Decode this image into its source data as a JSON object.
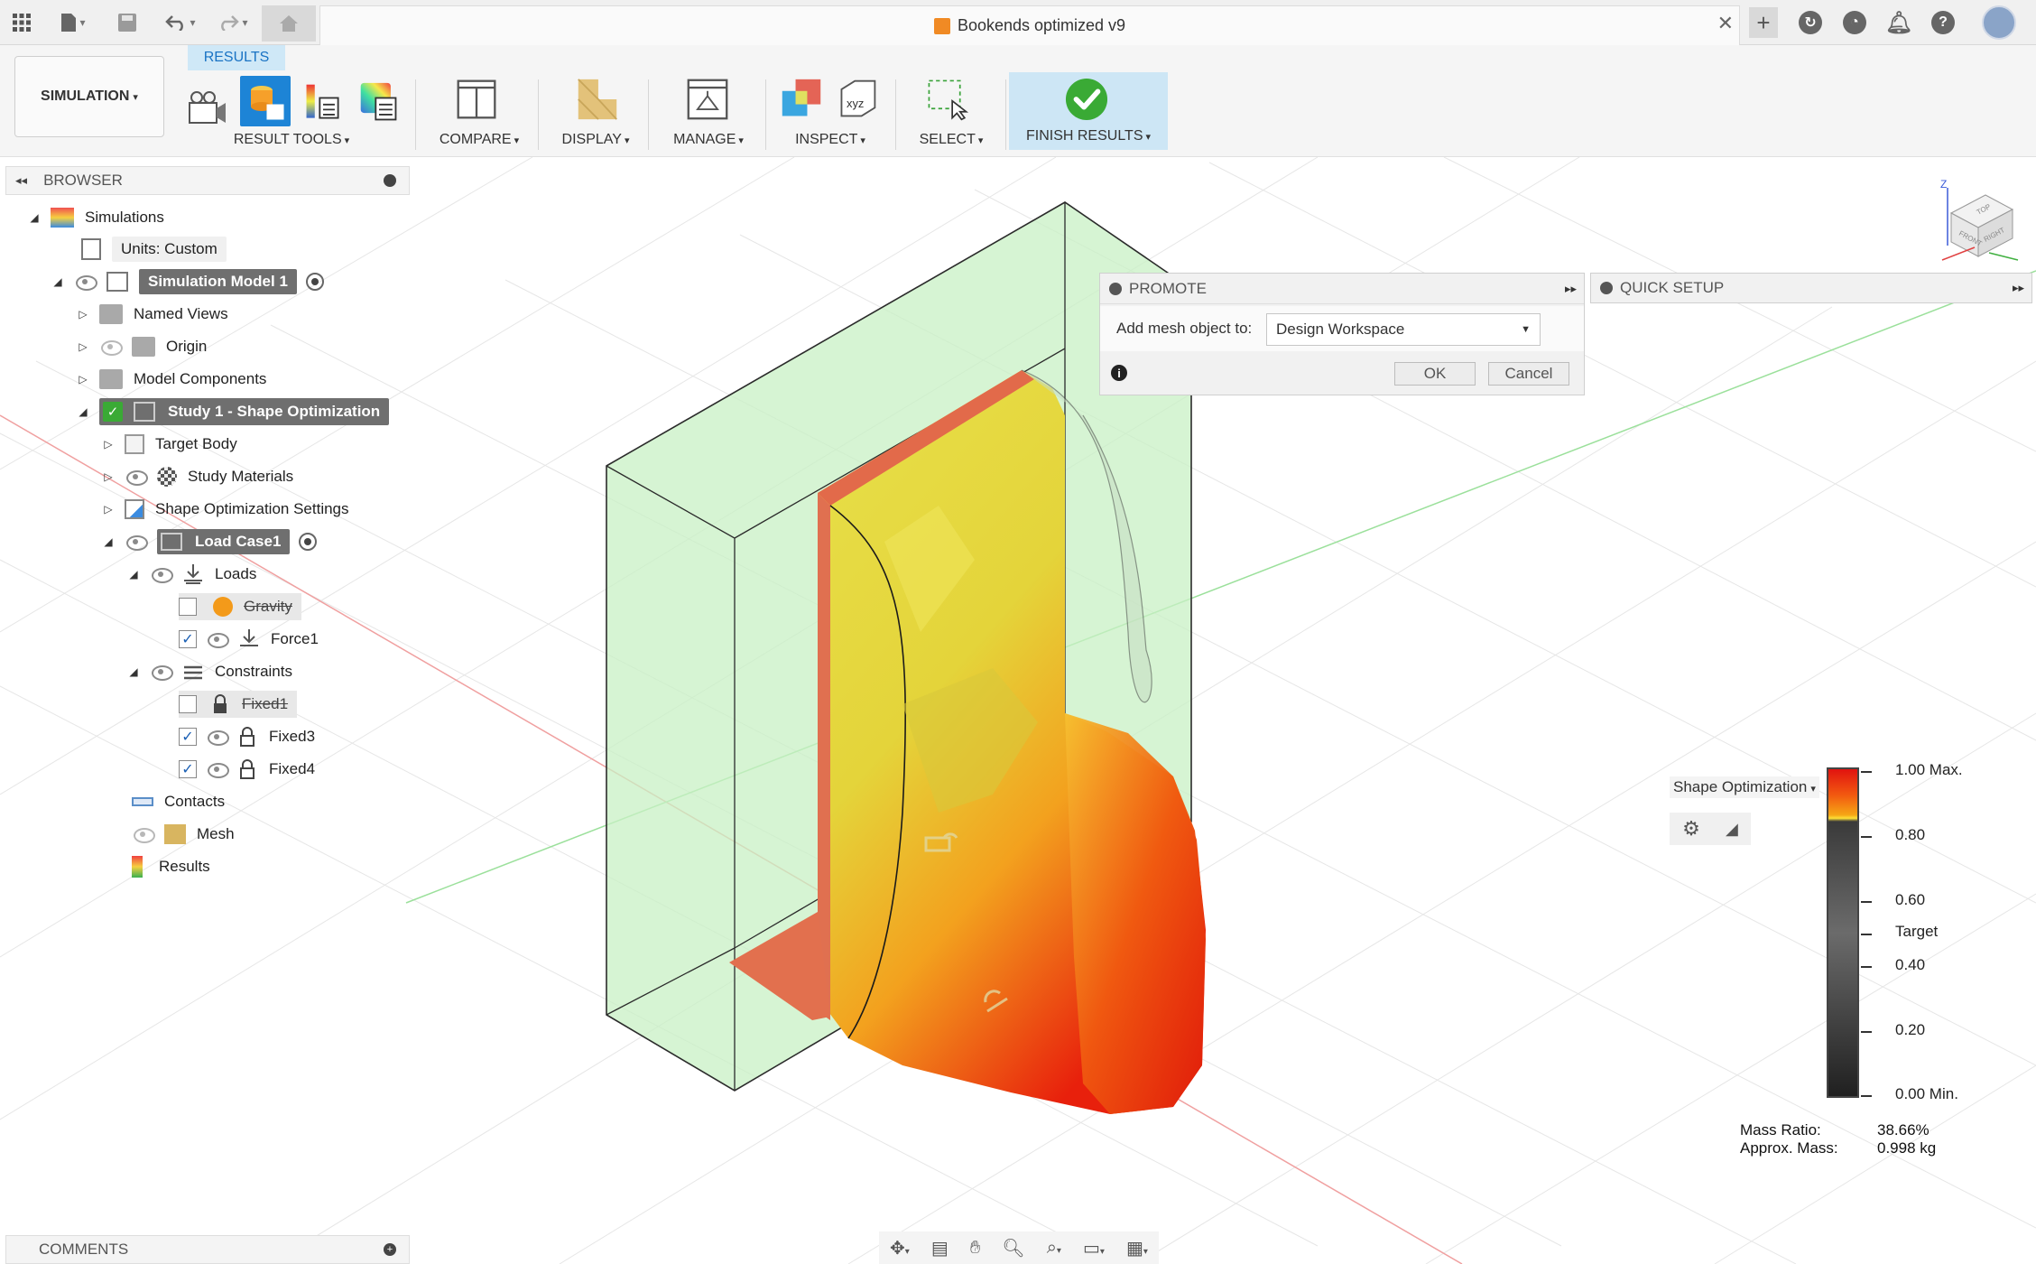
{
  "window": {
    "document_title": "Bookends optimized v9"
  },
  "toolbar": {
    "workspace_label": "SIMULATION",
    "active_tab": "RESULTS",
    "groups": {
      "result_tools": "RESULT TOOLS",
      "compare": "COMPARE",
      "display": "DISPLAY",
      "manage": "MANAGE",
      "inspect": "INSPECT",
      "select": "SELECT",
      "finish_results": "FINISH RESULTS"
    }
  },
  "browser": {
    "title": "BROWSER",
    "items": [
      {
        "label": "Simulations"
      },
      {
        "label": "Units: Custom"
      },
      {
        "label": "Simulation Model 1"
      },
      {
        "label": "Named Views"
      },
      {
        "label": "Origin"
      },
      {
        "label": "Model Components"
      },
      {
        "label": "Study 1 - Shape Optimization"
      },
      {
        "label": "Target Body"
      },
      {
        "label": "Study Materials"
      },
      {
        "label": "Shape Optimization Settings"
      },
      {
        "label": "Load Case1"
      },
      {
        "label": "Loads"
      },
      {
        "label": "Gravity"
      },
      {
        "label": "Force1"
      },
      {
        "label": "Constraints"
      },
      {
        "label": "Fixed1"
      },
      {
        "label": "Fixed3"
      },
      {
        "label": "Fixed4"
      },
      {
        "label": "Contacts"
      },
      {
        "label": "Mesh"
      },
      {
        "label": "Results"
      }
    ]
  },
  "comments": {
    "title": "COMMENTS"
  },
  "promote_dialog": {
    "title": "PROMOTE",
    "field_label": "Add mesh object to:",
    "selected_value": "Design Workspace",
    "ok_label": "OK",
    "cancel_label": "Cancel"
  },
  "quick_setup": {
    "title": "QUICK SETUP"
  },
  "legend": {
    "dropdown_label": "Shape Optimization",
    "scale": [
      "1.00 Max.",
      "0.80",
      "0.60",
      "Target",
      "0.40",
      "0.20",
      "0.00 Min."
    ],
    "mass_ratio_label": "Mass Ratio:",
    "mass_ratio_value": "38.66%",
    "approx_mass_label": "Approx. Mass:",
    "approx_mass_value": "0.998 kg"
  },
  "viewcube": {
    "faces": [
      "TOP",
      "FRONT",
      "RIGHT"
    ],
    "axis": "Z"
  },
  "colors": {
    "accent": "#1a73c4",
    "results_tab_bg": "#cfe8f7",
    "finish_bg": "#cde6f5",
    "check_green": "#3aaa35",
    "design_space_fill": "#c8f0c4",
    "optim_yellow": "#e8dc3a",
    "optim_red": "#e8200c"
  }
}
